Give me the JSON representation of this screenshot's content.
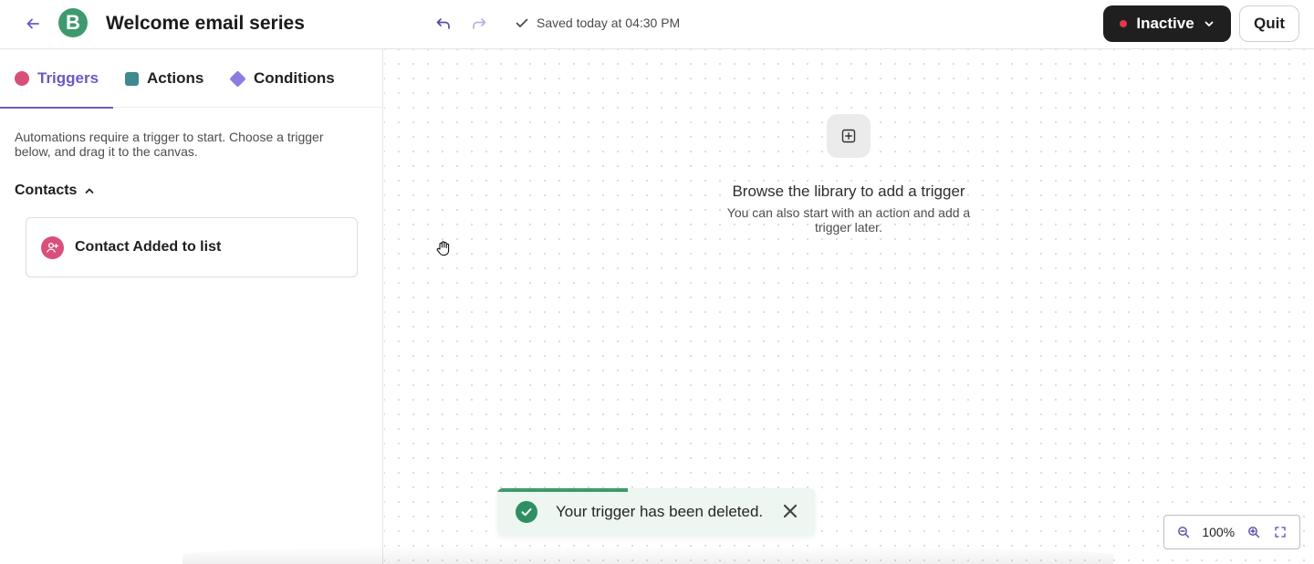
{
  "header": {
    "title": "Welcome email series",
    "saved_text": "Saved today at 04:30 PM",
    "status_label": "Inactive",
    "quit_label": "Quit",
    "logo_letter": "B"
  },
  "sidebar": {
    "tabs": [
      {
        "label": "Triggers",
        "active": true
      },
      {
        "label": "Actions",
        "active": false
      },
      {
        "label": "Conditions",
        "active": false
      }
    ],
    "intro": "Automations require a trigger to start. Choose a trigger below, and drag it to the canvas.",
    "group_title": "Contacts",
    "trigger_item": "Contact Added to list"
  },
  "canvas": {
    "empty_title": "Browse the library to add a trigger",
    "empty_sub": "You can also start with an action and add a trigger later.",
    "toast_message": "Your trigger has been deleted.",
    "toast_progress": 0.41,
    "zoom_level": "100%"
  },
  "colors": {
    "accent": "#6c58c4",
    "brand": "#3e9a6e",
    "trigger": "#d8507a",
    "action": "#3f8a8f",
    "condition": "#8f7be0",
    "inactive_dot": "#e0394e"
  },
  "icons": [
    "back-arrow-icon",
    "undo-icon",
    "redo-icon",
    "check-icon",
    "chevron-down-icon",
    "chevron-up-icon",
    "add-user-icon",
    "add-square-icon",
    "hand-cursor-icon",
    "success-check-icon",
    "close-icon",
    "zoom-out-icon",
    "zoom-in-icon",
    "fullscreen-icon"
  ]
}
